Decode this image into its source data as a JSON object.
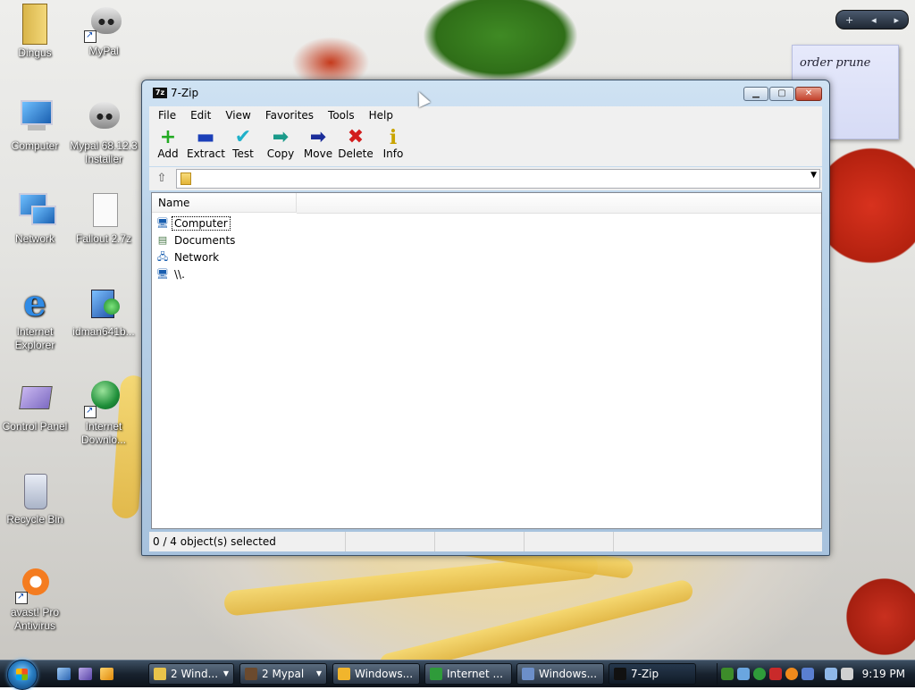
{
  "desktop": {
    "icons": [
      {
        "label": "Dingus"
      },
      {
        "label": "MyPal"
      },
      {
        "label": "Computer"
      },
      {
        "label": "Mypal 68.12.3 Installer"
      },
      {
        "label": "Network"
      },
      {
        "label": "Fallout 2.7z"
      },
      {
        "label": "Internet Explorer"
      },
      {
        "label": "idman641b..."
      },
      {
        "label": "Control Panel"
      },
      {
        "label": "Internet Downlo..."
      },
      {
        "label": "Recycle Bin"
      },
      {
        "label": "avast! Pro Antivirus"
      }
    ],
    "sidebar_note": {
      "text": "order prune"
    },
    "sidebar_controls": {
      "add": "+",
      "prev": "◂",
      "next": "▸"
    }
  },
  "window": {
    "title": "7-Zip",
    "app_icon_text": "7z",
    "controls": {
      "minimize": "▁",
      "maximize": "▢",
      "close": "✕"
    },
    "menu": [
      "File",
      "Edit",
      "View",
      "Favorites",
      "Tools",
      "Help"
    ],
    "toolbar": [
      {
        "label": "Add",
        "icon": "+",
        "color": "#22aa22",
        "icon_name": "add-icon"
      },
      {
        "label": "Extract",
        "icon": "▬",
        "color": "#1b3fb8",
        "icon_name": "extract-icon"
      },
      {
        "label": "Test",
        "icon": "✔",
        "color": "#1fb0c9",
        "icon_name": "test-icon"
      },
      {
        "label": "Copy",
        "icon": "➡",
        "color": "#1a9a8a",
        "icon_name": "copy-icon"
      },
      {
        "label": "Move",
        "icon": "➡",
        "color": "#1b2d9a",
        "icon_name": "move-icon"
      },
      {
        "label": "Delete",
        "icon": "✖",
        "color": "#d21c1c",
        "icon_name": "delete-icon"
      },
      {
        "label": "Info",
        "icon": "i",
        "color": "#c9a400",
        "icon_name": "info-icon"
      }
    ],
    "address": {
      "value": ""
    },
    "columns": {
      "name": "Name"
    },
    "items": [
      {
        "name": "Computer",
        "icon_name": "computer-icon",
        "glyph": "🖥"
      },
      {
        "name": "Documents",
        "icon_name": "documents-icon",
        "glyph": "▤"
      },
      {
        "name": "Network",
        "icon_name": "network-icon",
        "glyph": "🖧"
      },
      {
        "name": "\\\\.",
        "icon_name": "device-icon",
        "glyph": "🖥"
      }
    ],
    "status": {
      "selection": "0 / 4 object(s) selected"
    }
  },
  "taskbar": {
    "buttons": [
      {
        "label": "2 Wind...",
        "has_arrow": true,
        "icon_color": "#e8c34a"
      },
      {
        "label": "2 Mypal",
        "has_arrow": true,
        "icon_color": "#6b4a2e"
      },
      {
        "label": "Windows...",
        "has_arrow": false,
        "icon_color": "#f1b52c"
      },
      {
        "label": "Internet ...",
        "has_arrow": false,
        "icon_color": "#2f9b3a"
      },
      {
        "label": "Windows...",
        "has_arrow": false,
        "icon_color": "#6c8fc9"
      },
      {
        "label": "7-Zip",
        "has_arrow": false,
        "icon_color": "#111111"
      }
    ],
    "clock": "9:19 PM"
  }
}
